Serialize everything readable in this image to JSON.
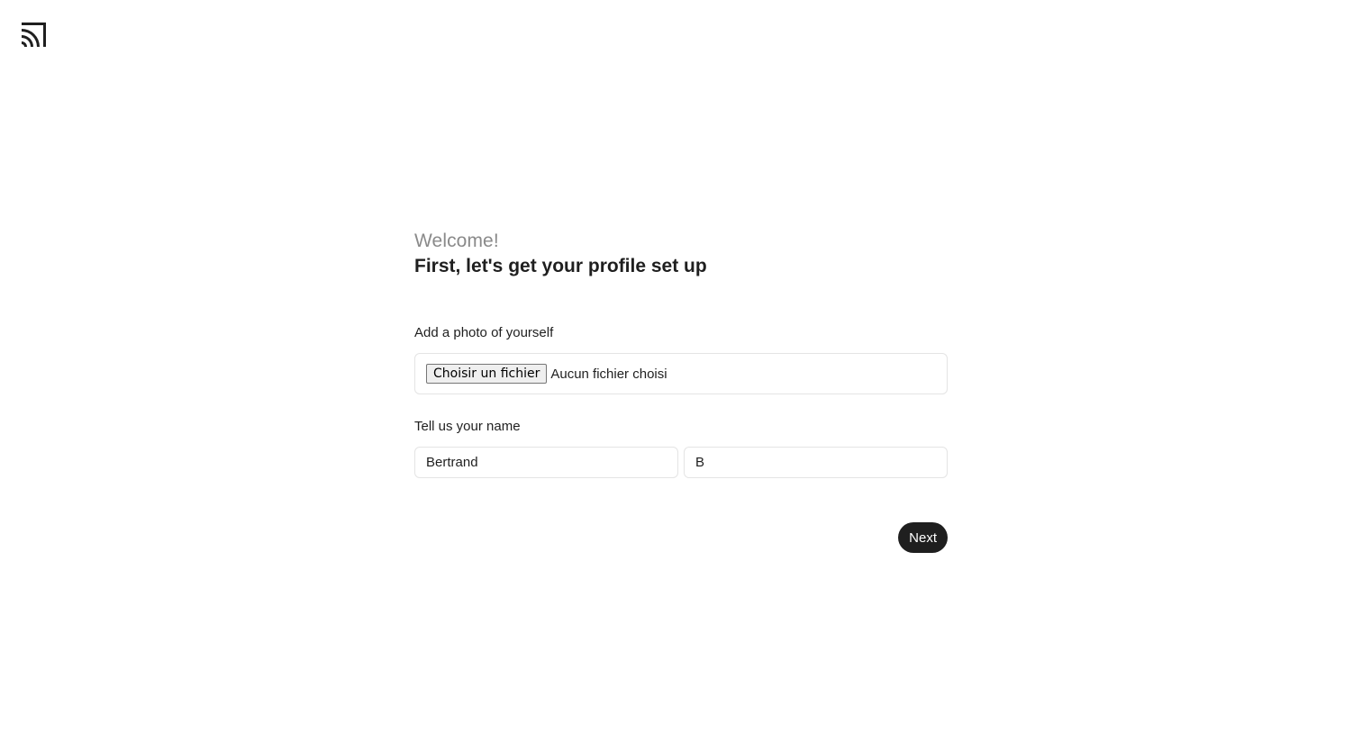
{
  "header": {
    "logo_icon": "broadcast-arcs-logo-icon"
  },
  "intro": {
    "welcome": "Welcome!",
    "headline": "First, let's get your profile set up"
  },
  "photo": {
    "label": "Add a photo of yourself",
    "button_label": "Choisir un fichier",
    "status": "Aucun fichier choisi"
  },
  "name": {
    "label": "Tell us your name",
    "first_name_value": "Bertrand",
    "last_name_value": "B"
  },
  "actions": {
    "next_label": "Next"
  },
  "colors": {
    "accent": "#1f1f1f",
    "muted_text": "#8a8a8a",
    "border": "#e4e4e4"
  }
}
